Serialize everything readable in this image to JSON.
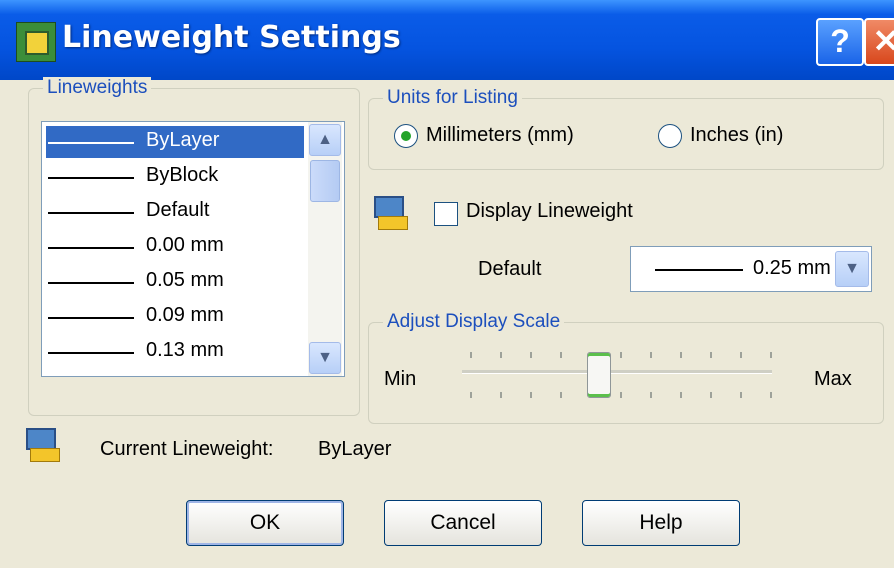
{
  "window": {
    "title": "Lineweight Settings"
  },
  "titlebar": {
    "help_glyph": "?",
    "close_glyph": "✕"
  },
  "lineweights": {
    "group_label": "Lineweights",
    "items": [
      {
        "label": "ByLayer",
        "selected": true
      },
      {
        "label": "ByBlock",
        "selected": false
      },
      {
        "label": "Default",
        "selected": false
      },
      {
        "label": "0.00 mm",
        "selected": false
      },
      {
        "label": "0.05 mm",
        "selected": false
      },
      {
        "label": "0.09 mm",
        "selected": false
      },
      {
        "label": "0.13 mm",
        "selected": false
      }
    ],
    "scroll_up_glyph": "▲",
    "scroll_down_glyph": "▼"
  },
  "units": {
    "group_label": "Units for Listing",
    "options": [
      {
        "label": "Millimeters (mm)",
        "selected": true
      },
      {
        "label": "Inches (in)",
        "selected": false
      }
    ]
  },
  "display": {
    "checkbox_label": "Display Lineweight",
    "checked": false,
    "icon": "lineweight-display-icon"
  },
  "default": {
    "label": "Default",
    "value": "0.25 mm",
    "dropdown_glyph": "▼"
  },
  "scale": {
    "group_label": "Adjust Display Scale",
    "min_label": "Min",
    "max_label": "Max",
    "position": 0.45
  },
  "current": {
    "label": "Current Lineweight:",
    "value": "ByLayer",
    "icon": "lineweight-current-icon"
  },
  "buttons": {
    "ok": "OK",
    "cancel": "Cancel",
    "help": "Help"
  },
  "colors": {
    "title_blue": "#0554e0",
    "group_label_blue": "#1c4fbd",
    "selection": "#316ac5",
    "radio_dot": "#23a328"
  }
}
